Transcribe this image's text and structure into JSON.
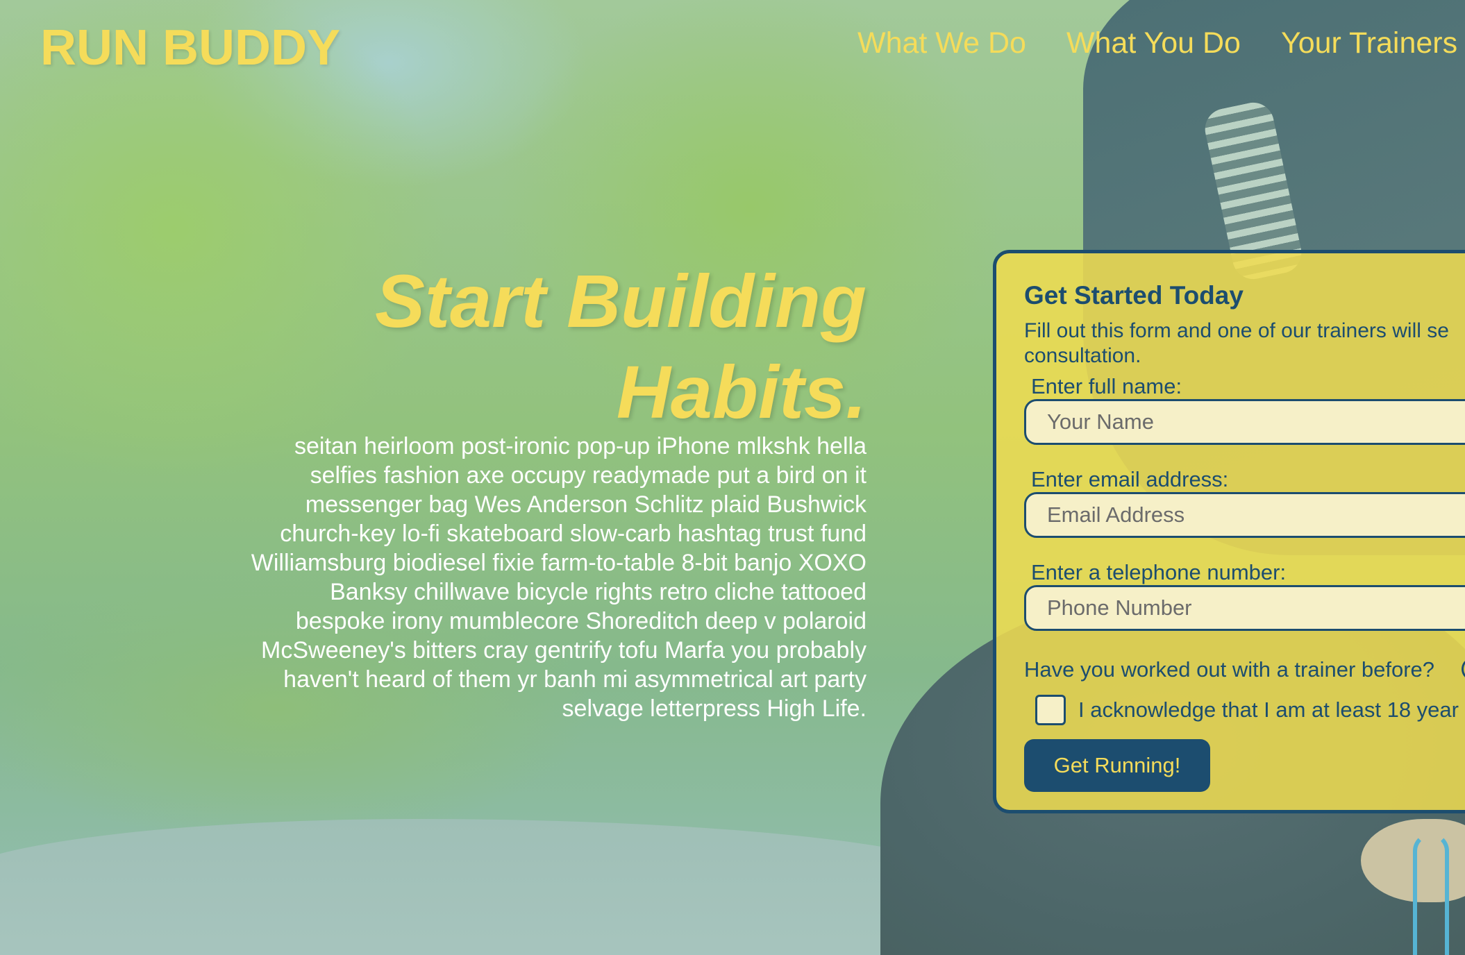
{
  "header": {
    "brand": "RUN BUDDY",
    "nav": [
      {
        "label": "What We Do"
      },
      {
        "label": "What You Do"
      },
      {
        "label": "Your Trainers"
      }
    ]
  },
  "hero": {
    "title_line1": "Start Building",
    "title_line2": "Habits.",
    "body": "seitan heirloom post-ironic pop-up iPhone mlkshk hella selfies fashion axe occupy readymade put a bird on it messenger bag Wes Anderson Schlitz plaid Bushwick church-key lo-fi skateboard slow-carb hashtag trust fund Williamsburg biodiesel fixie farm-to-table 8-bit banjo XOXO Banksy chillwave bicycle rights retro cliche tattooed bespoke irony mumblecore Shoreditch deep v polaroid McSweeney's bitters cray gentrify tofu Marfa you probably haven't heard of them yr banh mi asymmetrical art party selvage letterpress High Life."
  },
  "form": {
    "heading": "Get Started Today",
    "intro": "Fill out this form and one of our trainers will se consultation.",
    "name_label": "Enter full name:",
    "name_placeholder": "Your Name",
    "email_label": "Enter email address:",
    "email_placeholder": "Email Address",
    "phone_label": "Enter a telephone number:",
    "phone_placeholder": "Phone Number",
    "trainer_question": "Have you worked out with a trainer before?",
    "acknowledge": "I acknowledge that I am at least 18 year",
    "submit_label": "Get Running!"
  },
  "colors": {
    "accent_yellow": "#f5dc5a",
    "navy": "#1c4d6f",
    "form_bg": "#f0dc50",
    "input_bg": "#f6f0c8"
  }
}
